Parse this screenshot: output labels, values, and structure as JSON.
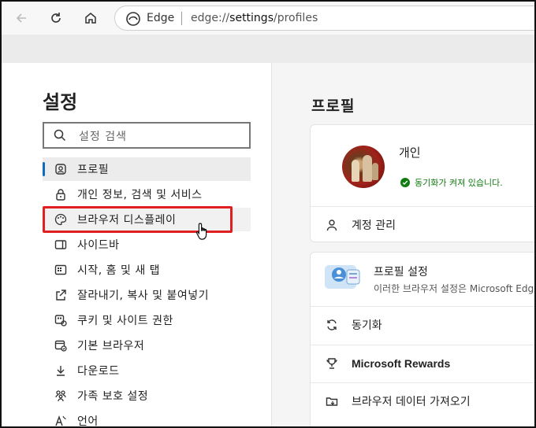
{
  "browser": {
    "brand": "Edge",
    "url_prefix": "edge://",
    "url_bold": "settings",
    "url_suffix": "/profiles"
  },
  "sidebar": {
    "title": "설정",
    "search_placeholder": "설정 검색",
    "items": [
      {
        "label": "프로필",
        "icon": "profile-icon"
      },
      {
        "label": "개인 정보, 검색 및 서비스",
        "icon": "lock-icon"
      },
      {
        "label": "브라우저 디스플레이",
        "icon": "palette-icon"
      },
      {
        "label": "사이드바",
        "icon": "sidebar-icon"
      },
      {
        "label": "시작, 홈 및 새 탭",
        "icon": "home-grid-icon"
      },
      {
        "label": "잘라내기, 복사 및 붙여넣기",
        "icon": "share-icon"
      },
      {
        "label": "쿠키 및 사이트 권한",
        "icon": "cookie-icon"
      },
      {
        "label": "기본 브라우저",
        "icon": "browser-icon"
      },
      {
        "label": "다운로드",
        "icon": "download-icon"
      },
      {
        "label": "가족 보호 설정",
        "icon": "family-icon"
      },
      {
        "label": "언어",
        "icon": "language-icon"
      }
    ]
  },
  "content": {
    "title": "프로필",
    "profile_name": "개인",
    "sync_status": "동기화가 켜져 있습니다.",
    "manage_account": "계정 관리",
    "profile_settings_title": "프로필 설정",
    "profile_settings_desc": "이러한 브라우저 설정은 Microsoft Edge",
    "sync": "동기화",
    "rewards": "Microsoft Rewards",
    "import_data": "브라우저 데이터 가져오기"
  },
  "colors": {
    "accent": "#0f6cbd",
    "highlight": "#e02020",
    "sync_green": "#107c10"
  }
}
